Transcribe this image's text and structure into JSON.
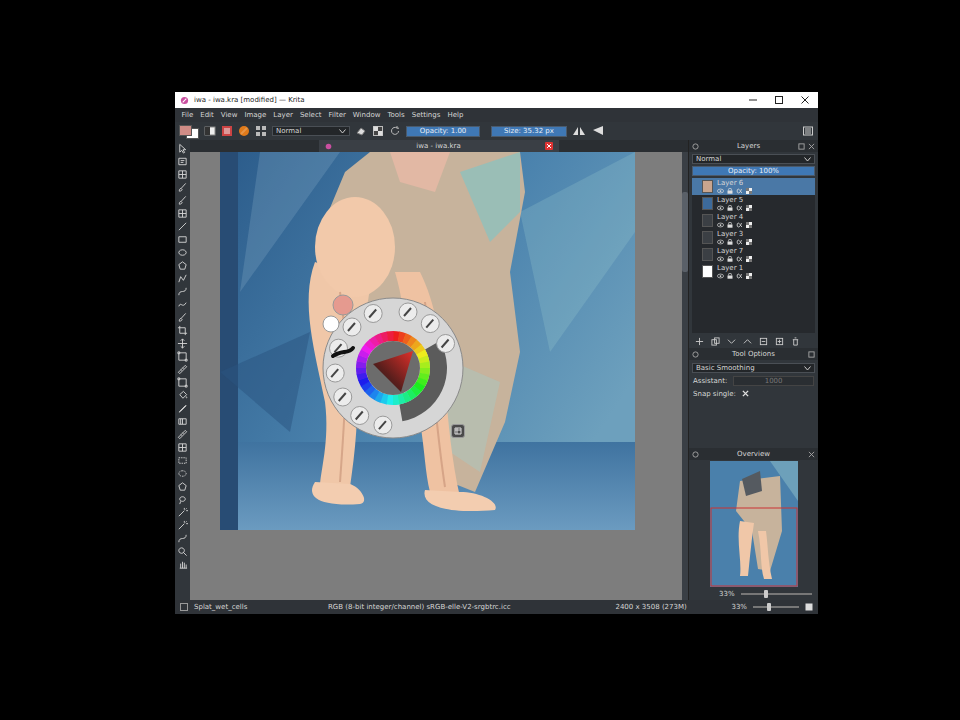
{
  "window": {
    "title": "iwa - iwa.kra [modified] — Krita"
  },
  "menu": [
    "File",
    "Edit",
    "View",
    "Image",
    "Layer",
    "Select",
    "Filter",
    "Window",
    "Tools",
    "Settings",
    "Help"
  ],
  "toolbar": {
    "colors": [
      {
        "color": "#d08c86"
      },
      {
        "color": "#ffffff"
      }
    ],
    "blend_mode": "Normal",
    "opacity": {
      "label": "Opacity: 1.00",
      "level": 1
    },
    "size": {
      "label": "Size: 35.32 px",
      "level": 1
    }
  },
  "document_tab": {
    "label": "iwa - iwa.kra",
    "selected": true
  },
  "popup_palette": {
    "recent_colors": [
      {
        "color": "#e59a8f"
      },
      {
        "color": "#ffffff"
      }
    ]
  },
  "layers": {
    "title": "Layers",
    "blend_mode": "Normal",
    "opacity": {
      "label": "Opacity: 100%",
      "level": 1
    },
    "items": [
      {
        "name": "Layer 6",
        "selected": true,
        "color": "#c9a58e"
      },
      {
        "name": "Layer 5",
        "selected": false,
        "color": "#3d6a9a"
      },
      {
        "name": "Layer 4",
        "selected": false,
        "color": "#3b3f44"
      },
      {
        "name": "Layer 3",
        "selected": false,
        "color": "#3b3f44"
      },
      {
        "name": "Layer 7",
        "selected": false,
        "color": "#3b3f44"
      },
      {
        "name": "Layer 1",
        "selected": false,
        "color": "#ffffff"
      }
    ]
  },
  "tool_options": {
    "title": "Tool Options",
    "smoothing": "Basic Smoothing",
    "assistant": {
      "label": "Assistant:",
      "value": "1000"
    },
    "snap_single": {
      "label": "Snap single:",
      "checked": true
    }
  },
  "overview": {
    "title": "Overview",
    "zoom": "33%",
    "level": 0.33
  },
  "status_bar": {
    "brush": "Splat_wet_cells",
    "color_space": "RGB (8-bit integer/channel)  sRGB-elle-V2-srgbtrc.icc",
    "dimensions": "2400 x 3508 (273M)",
    "zoom": "33%",
    "zoom_level": 0.3
  }
}
